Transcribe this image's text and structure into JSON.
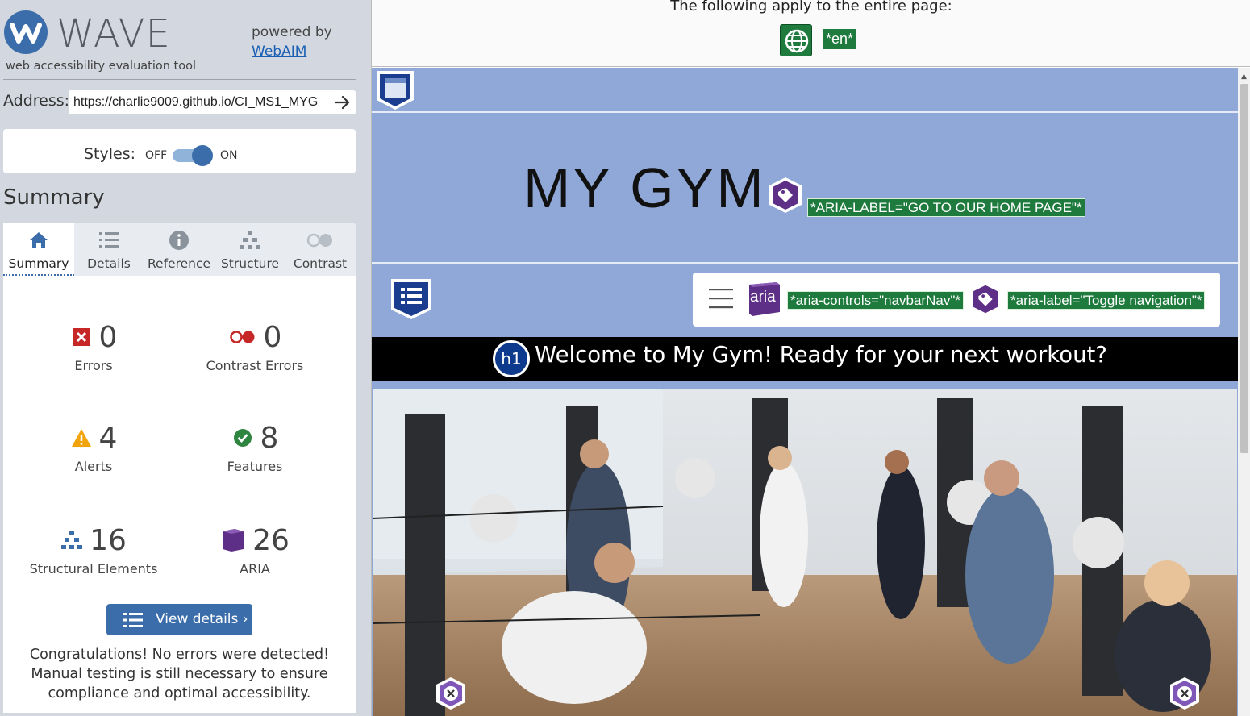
{
  "wave": {
    "logo_word": "WAVE",
    "tagline": "web accessibility evaluation tool",
    "powered_by": "powered by",
    "webaim_link": "WebAIM",
    "address_label": "Address:",
    "address_value": "https://charlie9009.github.io/CI_MS1_MYG",
    "styles_label": "Styles:",
    "styles_off": "OFF",
    "styles_on": "ON",
    "summary_heading": "Summary",
    "tabs": [
      {
        "label": "Summary",
        "icon": "home-icon",
        "active": true
      },
      {
        "label": "Details",
        "icon": "list-icon"
      },
      {
        "label": "Reference",
        "icon": "info-icon"
      },
      {
        "label": "Structure",
        "icon": "hierarchy-icon"
      },
      {
        "label": "Contrast",
        "icon": "contrast-icon"
      }
    ],
    "stats": {
      "errors": {
        "num": "0",
        "label": "Errors"
      },
      "contrast_errors": {
        "num": "0",
        "label": "Contrast Errors"
      },
      "alerts": {
        "num": "4",
        "label": "Alerts"
      },
      "features": {
        "num": "8",
        "label": "Features"
      },
      "structural": {
        "num": "16",
        "label": "Structural Elements"
      },
      "aria": {
        "num": "26",
        "label": "ARIA"
      }
    },
    "view_details": "View details ›",
    "congrats": "Congratulations! No errors were detected! Manual testing is still necessary to ensure compliance and optimal accessibility."
  },
  "preview": {
    "banner_text": "The following apply to the entire page:",
    "lang_badge": "*en*",
    "brand": "MY GYM",
    "brand_aria": "*ARIA-LABEL=\"GO TO OUR HOME PAGE\"*",
    "aria_icon_text": "aria",
    "aria_controls": "*aria-controls=\"navbarNav\"*",
    "aria_toggle": "*aria-label=\"Toggle navigation\"*",
    "h1_badge": "h1",
    "h1_text": "Welcome to My Gym! Ready for your next workout?"
  },
  "colors": {
    "wave_blue": "#3b6dab",
    "error_red": "#c62828",
    "alert_orange": "#f0a30a",
    "feature_green": "#2e8540",
    "aria_purple": "#5d2f86",
    "label_green": "#1e7a3d",
    "site_bg": "#8fa8d8"
  }
}
